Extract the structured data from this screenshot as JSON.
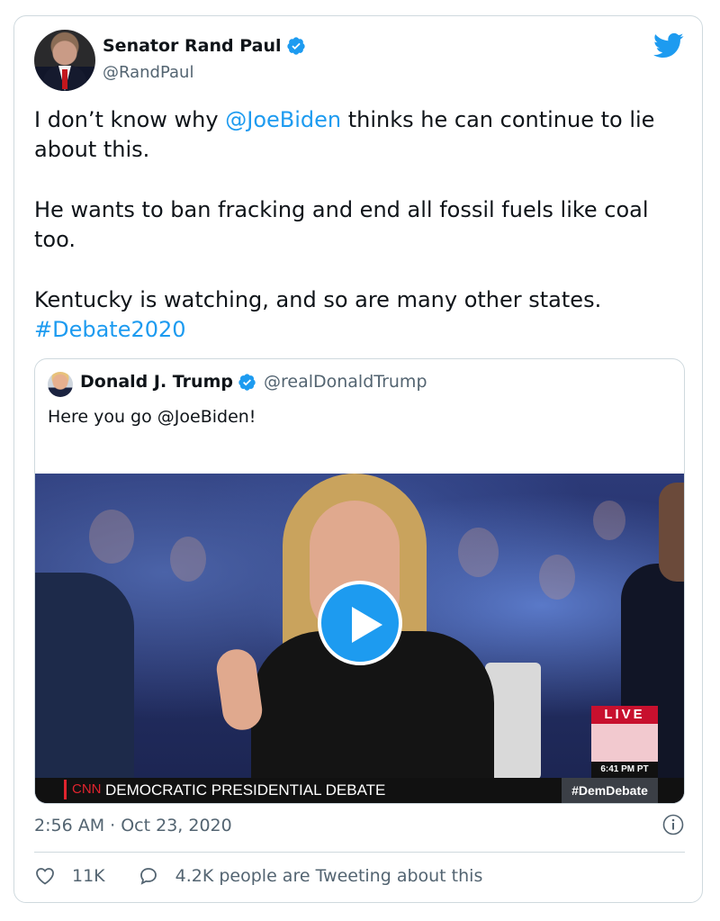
{
  "tweet": {
    "author_name": "Senator Rand Paul",
    "author_handle": "@RandPaul",
    "text": {
      "p1_before": "I don’t know why ",
      "p1_mention": "@JoeBiden",
      "p1_after": " thinks he can continue to lie about this.",
      "p2": "He wants to ban fracking and end all fossil fuels like coal too.",
      "p3": "Kentucky is watching, and so are many other states.",
      "hashtag": "#Debate2020"
    },
    "timestamp": "2:56 AM · Oct 23, 2020",
    "likes": "11K",
    "replies_text": "4.2K people are Tweeting about this"
  },
  "quoted": {
    "author_name": "Donald J. Trump",
    "author_handle": "@realDonaldTrump",
    "text": "Here you go @JoeBiden!"
  },
  "video": {
    "live_label": "LIVE",
    "time_label": "6:41 PM PT",
    "network": "CNN",
    "banner": "DEMOCRATIC PRESIDENTIAL DEBATE",
    "hashtag": "#DemDebate"
  },
  "icons": {
    "brand": "twitter-bird-icon",
    "verified": "verified-badge-icon",
    "play": "play-icon",
    "info": "info-icon",
    "like": "heart-icon",
    "reply": "speech-bubble-icon"
  },
  "colors": {
    "accent": "#1d9bf0",
    "text_primary": "#0f1419",
    "text_secondary": "#536471",
    "border": "#cfd9de",
    "live_red": "#c8102e"
  }
}
